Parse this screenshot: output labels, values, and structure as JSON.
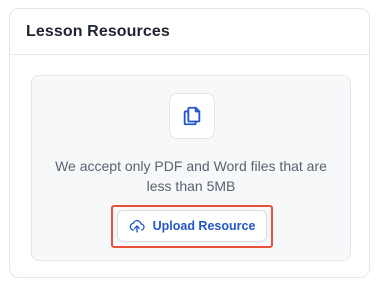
{
  "card": {
    "title": "Lesson Resources"
  },
  "dropzone": {
    "icon": "copy-file-icon",
    "hint": "We accept only PDF and Word files that are less than 5MB",
    "upload_button": {
      "icon": "cloud-upload-icon",
      "label": "Upload Resource"
    }
  },
  "colors": {
    "accent": "#2356c8",
    "highlight": "#e8523b",
    "dropzone_bg": "#f7f8fa"
  }
}
